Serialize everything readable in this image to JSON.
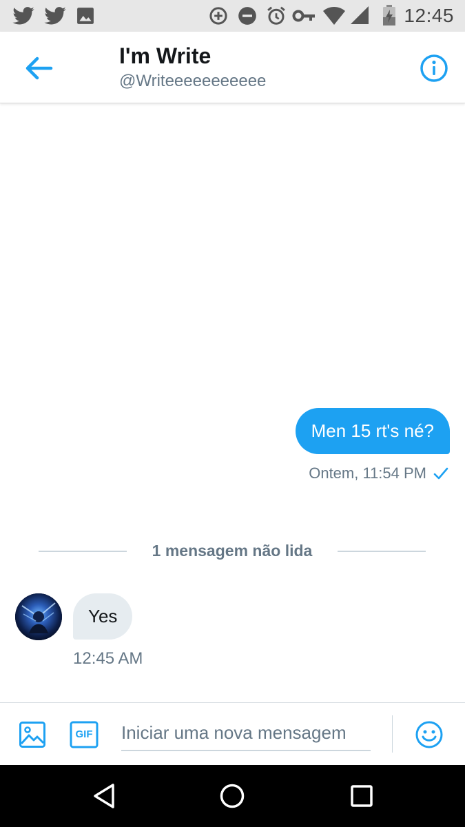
{
  "status_bar": {
    "time": "12:45",
    "icons": [
      "twitter-icon",
      "twitter-icon",
      "image-icon",
      "data-saver-icon",
      "do-not-disturb-icon",
      "alarm-icon",
      "vpn-key-icon",
      "wifi-icon",
      "signal-icon",
      "battery-charging-icon"
    ]
  },
  "header": {
    "name": "I'm Write",
    "handle": "@Writeeeeeeeeeee",
    "back_icon": "back-arrow-icon",
    "info_icon": "info-icon"
  },
  "conversation": {
    "sent_message": {
      "text": "Men 15 rt's né?",
      "timestamp": "Ontem, 11:54 PM",
      "status_icon": "checkmark-icon"
    },
    "unread_divider": "1 mensagem não lida",
    "received_message": {
      "text": "Yes",
      "timestamp": "12:45 AM"
    }
  },
  "composer": {
    "placeholder": "Iniciar uma nova mensagem",
    "value": "",
    "gif_label": "GIF",
    "icons": [
      "image-icon",
      "gif-icon",
      "emoji-icon"
    ]
  },
  "colors": {
    "accent": "#1da1f2",
    "secondary_text": "#657786",
    "received_bubble": "#e6ecf0"
  }
}
